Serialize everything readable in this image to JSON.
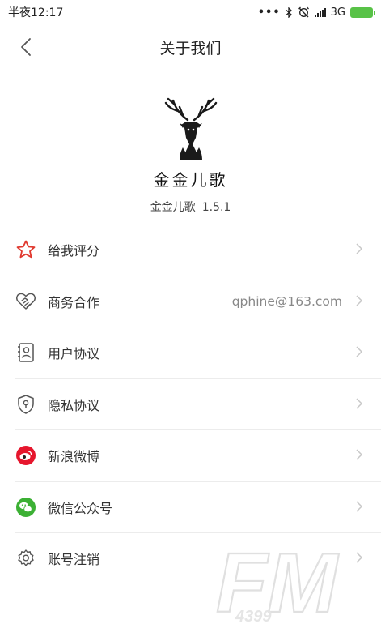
{
  "status_bar": {
    "time": "半夜12:17",
    "network": "3G"
  },
  "header": {
    "title": "关于我们"
  },
  "app": {
    "logo_text": "金金儿歌",
    "name": "金金儿歌",
    "version": "1.5.1"
  },
  "menu": {
    "items": [
      {
        "label": "给我评分",
        "icon": "star-icon",
        "icon_color": "#e0392f"
      },
      {
        "label": "商务合作",
        "value": "qphine@163.com",
        "icon": "handshake-icon"
      },
      {
        "label": "用户协议",
        "icon": "contact-card-icon"
      },
      {
        "label": "隐私协议",
        "icon": "shield-lock-icon"
      },
      {
        "label": "新浪微博",
        "icon": "weibo-icon",
        "icon_color": "#e6162d"
      },
      {
        "label": "微信公众号",
        "icon": "wechat-icon",
        "icon_color": "#3cb034"
      },
      {
        "label": "账号注销",
        "icon": "gear-icon"
      }
    ]
  },
  "watermark": {
    "text": "FM",
    "subtext": "4399"
  },
  "colors": {
    "battery": "#58c247",
    "divider": "#ececec",
    "chevron": "#c8c8c8"
  }
}
